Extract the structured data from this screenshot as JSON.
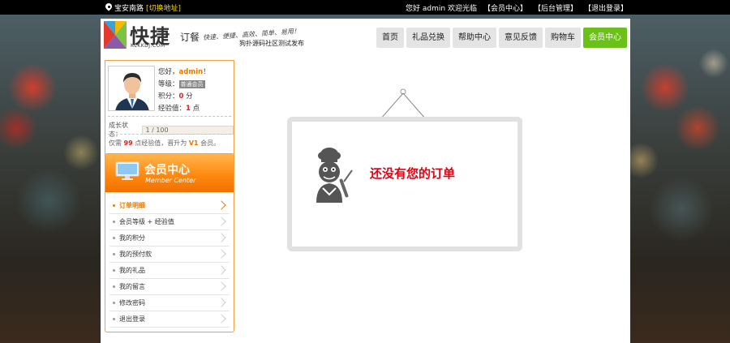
{
  "topbar": {
    "location": "宝安南路",
    "switch_label": "[切换地址]",
    "greeting": "您好 admin 欢迎光临",
    "links": [
      "【会员中心】",
      "【后台管理】",
      "【退出登录】"
    ]
  },
  "header": {
    "logo_text": "快捷",
    "logo_sub": "订餐",
    "logo_url": "KLKKDJ.COM",
    "slogan": "快速、便捷、高效、简单、易用！",
    "tagline": "狗扑源码社区测试发布",
    "nav": [
      "首页",
      "礼品兑换",
      "帮助中心",
      "意见反馈",
      "购物车",
      "会员中心"
    ],
    "nav_active": "会员中心"
  },
  "user": {
    "hello_prefix": "您好，",
    "username": "admin",
    "hello_suffix": "！",
    "level_label": "等级：",
    "level_value": "普通会员",
    "points_label": "积分：",
    "points_value": "0",
    "points_unit": "分",
    "exp_label": "经验值：",
    "exp_value": "1",
    "exp_unit": "点",
    "growth_label": "成长状态：",
    "growth_value": "1 / 100",
    "tip_prefix": "仅需",
    "tip_need": "99",
    "tip_mid": "点经验值，晋升为",
    "tip_level": "V1",
    "tip_suffix": "会员。"
  },
  "member_center": {
    "title": "会员中心",
    "subtitle": "Member Center",
    "items": [
      "订单明细",
      "会员等级 + 经验值",
      "我的积分",
      "我的预付款",
      "我的礼品",
      "我的留言",
      "修改密码",
      "退出登录"
    ],
    "active": "订单明细"
  },
  "main": {
    "empty_message": "还没有您的订单"
  },
  "colors": {
    "accent_green": "#6bc11a",
    "accent_orange": "#ff8a10",
    "alert_red": "#e60012"
  }
}
